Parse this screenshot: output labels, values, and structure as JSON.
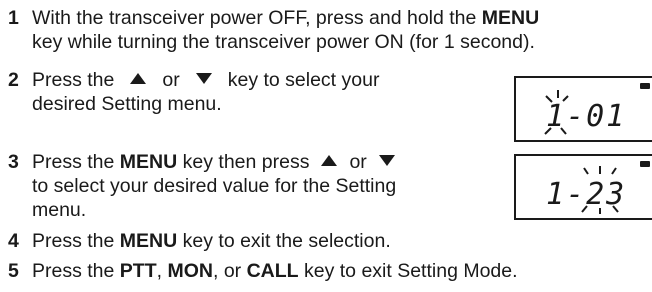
{
  "steps": [
    {
      "num": "1",
      "line1_a": "With the transceiver power OFF, press and hold the ",
      "line1_key": "MENU",
      "line2": "key while turning the transceiver power ON (for 1 second)."
    },
    {
      "num": "2",
      "line1_a": "Press the",
      "line1_or": "or",
      "line1_b": "key to select your",
      "line2": "desired Setting menu."
    },
    {
      "num": "3",
      "line1_a": "Press the ",
      "line1_key": "MENU",
      "line1_b": " key then press",
      "line1_or": "or",
      "line2": "to select your desired value for the Setting",
      "line3": "menu."
    },
    {
      "num": "4",
      "line1_a": "Press the ",
      "line1_key": "MENU",
      "line1_b": " key to exit the selection."
    },
    {
      "num": "5",
      "line1_a": "Press the ",
      "key1": "PTT",
      "sep1": ", ",
      "key2": "MON",
      "sep2": ", or ",
      "key3": "CALL",
      "line1_b": " key to exit Setting Mode."
    }
  ],
  "displays": [
    {
      "text": "1-01",
      "blinking": "1"
    },
    {
      "text": "1-23",
      "blinking": "23"
    }
  ],
  "icons": {
    "up": "up-triangle-icon",
    "down": "down-triangle-icon",
    "battery": "battery-icon"
  }
}
